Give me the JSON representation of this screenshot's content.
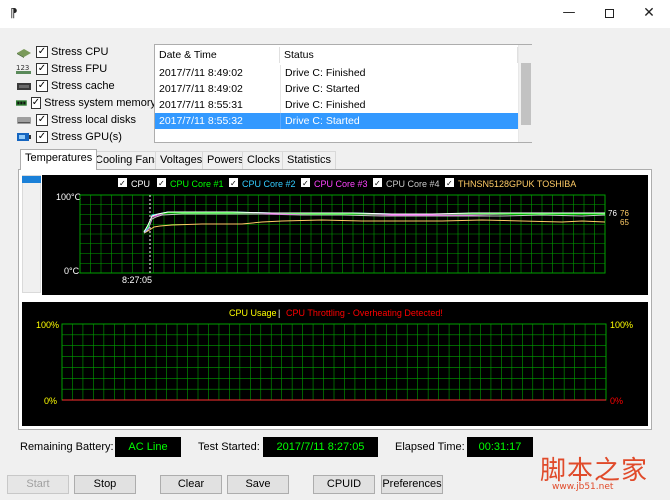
{
  "window": {
    "app_icon": "⁋",
    "minimize_glyph": "—",
    "close_glyph": "✕"
  },
  "stress_items": [
    {
      "label": "Stress CPU",
      "icon": "cpu-chip-icon",
      "checked": true
    },
    {
      "label": "Stress FPU",
      "icon": "fpu-numbers-icon",
      "checked": true
    },
    {
      "label": "Stress cache",
      "icon": "cache-icon",
      "checked": true
    },
    {
      "label": "Stress system memory",
      "icon": "memory-module-icon",
      "checked": true
    },
    {
      "label": "Stress local disks",
      "icon": "disk-icon",
      "checked": true
    },
    {
      "label": "Stress GPU(s)",
      "icon": "gpu-icon",
      "checked": true
    }
  ],
  "log": {
    "headers": [
      "Date & Time",
      "Status"
    ],
    "rows": [
      {
        "datetime": "2017/7/11 8:49:02",
        "status": "Drive C: Finished",
        "selected": false
      },
      {
        "datetime": "2017/7/11 8:49:02",
        "status": "Drive C: Started",
        "selected": false
      },
      {
        "datetime": "2017/7/11 8:55:31",
        "status": "Drive C: Finished",
        "selected": false
      },
      {
        "datetime": "2017/7/11 8:55:32",
        "status": "Drive C: Started",
        "selected": true
      }
    ]
  },
  "tabs": [
    "Temperatures",
    "Cooling Fans",
    "Voltages",
    "Powers",
    "Clocks",
    "Statistics"
  ],
  "temp_chart": {
    "legend": [
      {
        "label": "CPU",
        "color": "#ffffff"
      },
      {
        "label": "CPU Core #1",
        "color": "#00ff00"
      },
      {
        "label": "CPU Core #2",
        "color": "#33ccff"
      },
      {
        "label": "CPU Core #3",
        "color": "#ff44ff"
      },
      {
        "label": "CPU Core #4",
        "color": "#c8c8c8"
      },
      {
        "label": "THNSN5128GPUK TOSHIBA",
        "color": "#ffcc66"
      }
    ],
    "y_top_label": "100°C",
    "y_bottom_label": "0°C",
    "x_marker_label": "8:27:05",
    "end_labels": [
      {
        "text": "76",
        "color": "#ffffff"
      },
      {
        "text": "76",
        "color": "#ffcc66"
      },
      {
        "text": "65",
        "color": "#ffcc66"
      }
    ],
    "grid_color": "#00a000",
    "ylim": [
      0,
      100
    ]
  },
  "usage_chart": {
    "title_usage": "CPU Usage",
    "separator": "|",
    "title_throttle": "CPU Throttling - Overheating Detected!",
    "left_top": "100%",
    "left_bottom": "0%",
    "right_top": "100%",
    "right_bottom": "0%",
    "usage_color": "#ffff00",
    "throttle_color": "#ff0000",
    "grid_color": "#00a000"
  },
  "status": {
    "battery_label": "Remaining Battery:",
    "battery_value": "AC Line",
    "started_label": "Test Started:",
    "started_value": "2017/7/11 8:27:05",
    "elapsed_label": "Elapsed Time:",
    "elapsed_value": "00:31:17"
  },
  "buttons": {
    "start": "Start",
    "stop": "Stop",
    "clear": "Clear",
    "save": "Save",
    "cpuid": "CPUID",
    "preferences": "Preferences"
  },
  "watermark": {
    "text": "脚本之家",
    "url": "www.jb51.net"
  }
}
